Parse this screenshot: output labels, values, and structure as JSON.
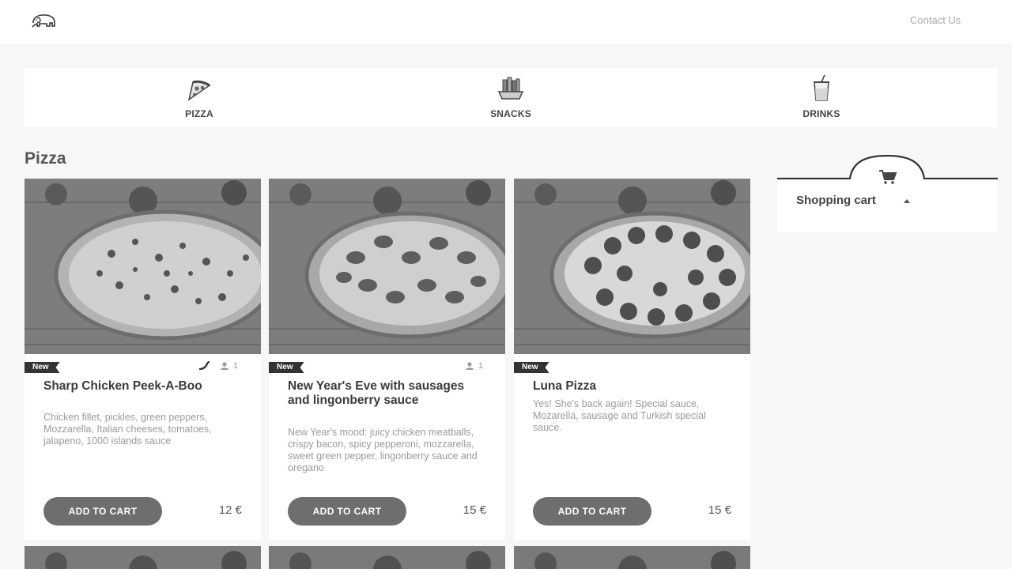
{
  "header": {
    "logo": "elephant-logo",
    "contact_label": "Contact Us"
  },
  "categories": [
    {
      "label": "PIZZA",
      "icon": "pizza-icon"
    },
    {
      "label": "SNACKS",
      "icon": "snacks-icon"
    },
    {
      "label": "DRINKS",
      "icon": "drinks-icon"
    }
  ],
  "section_title": "Pizza",
  "products": [
    {
      "badge": "New",
      "spicy": true,
      "persons": "1",
      "title": "Sharp Chicken Peek-A-Boo",
      "description": "Chicken fillet, pickles, green peppers, Mozzarella, Italian cheeses, tomatoes, jalapeno, 1000 islands sauce",
      "button": "ADD TO CART",
      "price": "12 €"
    },
    {
      "badge": "New",
      "spicy": false,
      "persons": "1",
      "title": "New Year's Eve with sausages and lingonberry sauce",
      "description": "New Year's mood: juicy chicken meatballs, crispy bacon, spicy pepperoni, mozzarella, sweet green pepper, lingonberry sauce and oregano",
      "button": "ADD TO CART",
      "price": "15 €"
    },
    {
      "badge": "New",
      "spicy": false,
      "persons": "",
      "title": "Luna Pizza",
      "description": "Yes! She's back again! Special sauce, Mozarella, sausage and Turkish special sauce.",
      "button": "ADD TO CART",
      "price": "15 €"
    }
  ],
  "cart": {
    "title": "Shopping cart",
    "icon": "cart-icon"
  }
}
